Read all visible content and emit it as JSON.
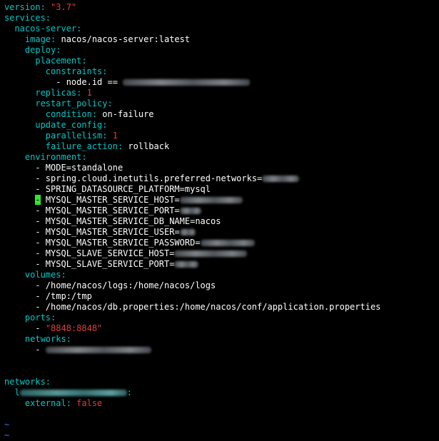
{
  "editor": {
    "lines": {
      "version_key": "version",
      "version_value": "\"3.7\"",
      "services_key": "services",
      "nacos_server_key": "nacos-server",
      "image_key": "image",
      "image_value": "nacos/nacos-server:latest",
      "deploy_key": "deploy",
      "placement_key": "placement",
      "constraints_key": "constraints",
      "constraint_item": "- node.id == ",
      "replicas_key": "replicas",
      "replicas_value": "1",
      "restart_policy_key": "restart_policy",
      "condition_key": "condition",
      "condition_value": "on-failure",
      "update_config_key": "update_config",
      "parallelism_key": "parallelism",
      "parallelism_value": "1",
      "failure_action_key": "failure_action",
      "failure_action_value": "rollback",
      "environment_key": "environment",
      "env_mode": "- MODE=standalone",
      "env_preferred_networks": "- spring.cloud.inetutils.preferred-networks=",
      "env_datasource_platform": "- SPRING_DATASOURCE_PLATFORM=mysql",
      "env_master_host_dash": "-",
      "env_master_host": " MYSQL_MASTER_SERVICE_HOST=",
      "env_master_port": "- MYSQL_MASTER_SERVICE_PORT=",
      "env_master_db_name": "- MYSQL_MASTER_SERVICE_DB_NAME=nacos",
      "env_master_user": "- MYSQL_MASTER_SERVICE_USER=",
      "env_master_password": "- MYSQL_MASTER_SERVICE_PASSWORD=",
      "env_slave_host": "- MYSQL_SLAVE_SERVICE_HOST=",
      "env_slave_port": "- MYSQL_SLAVE_SERVICE_PORT=",
      "volumes_key": "volumes",
      "volume_logs": "- /home/nacos/logs:/home/nacos/logs",
      "volume_tmp": "- /tmp:/tmp",
      "volume_db_properties": "- /home/nacos/db.properties:/home/nacos/conf/application.properties",
      "ports_key": "ports",
      "ports_dash": "- ",
      "port_value": "\"8848:8848\"",
      "networks_key": "networks",
      "network_item_dash": "- ",
      "top_networks_key": "networks",
      "network_name_prefix": "l",
      "external_key": "external",
      "external_value": "false",
      "tilde": "~"
    }
  },
  "colors": {
    "background": "#000000",
    "key": "#00c8c8",
    "string": "#e03c3c",
    "text": "#ffffff",
    "tilde": "#4a6fe0",
    "cursor": "#2ee82e"
  }
}
